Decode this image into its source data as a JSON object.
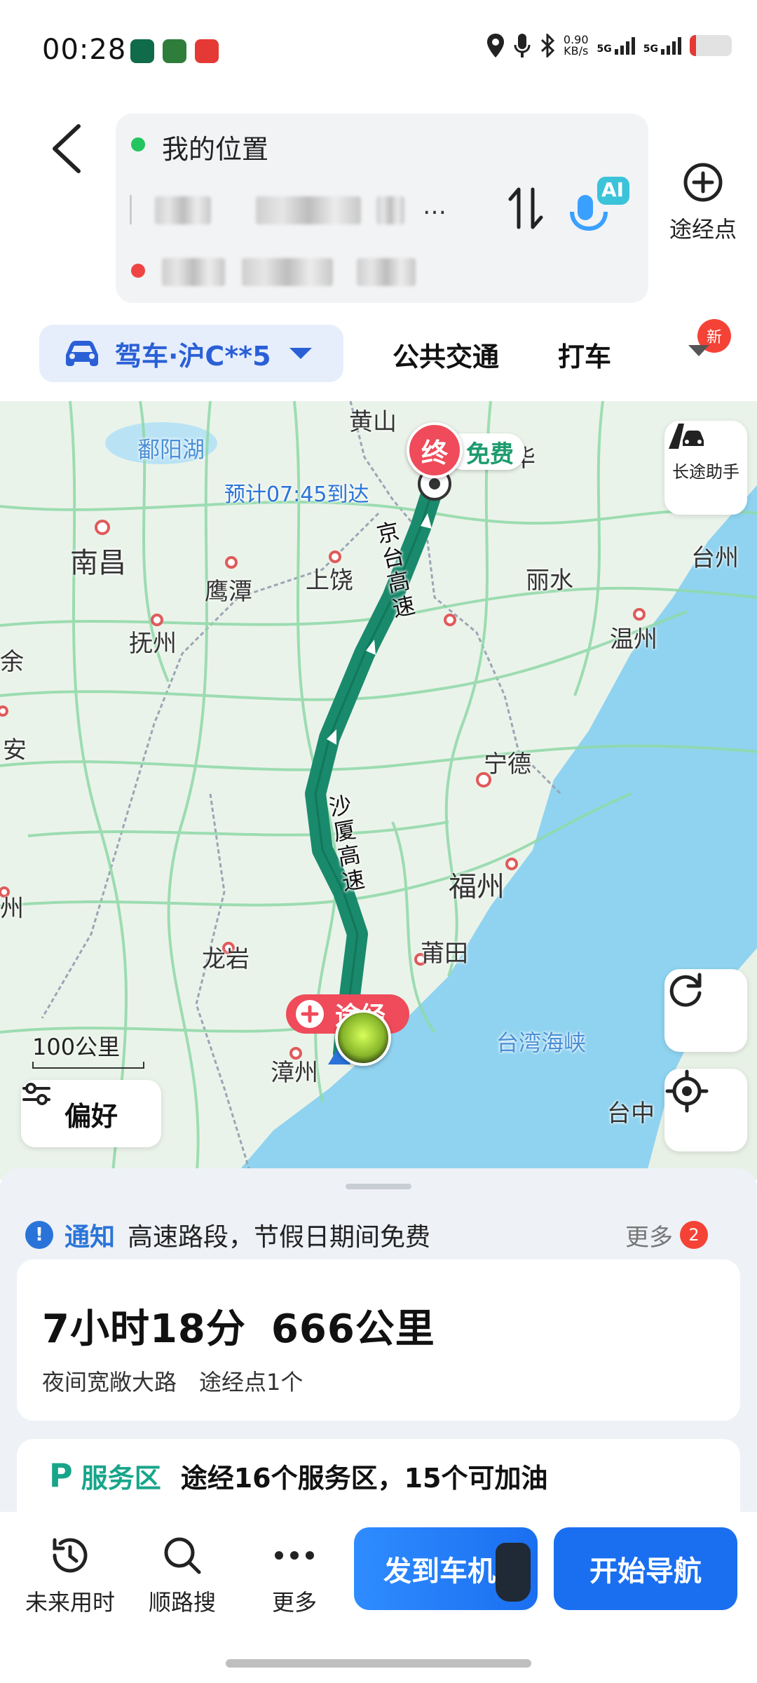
{
  "status_bar": {
    "time": "00:28",
    "net_speed_value": "0.90",
    "net_speed_unit": "KB/s",
    "signal1_label": "5G",
    "signal2_label": "5G",
    "battery_level": 0.15,
    "battery_color": "#e53935"
  },
  "search": {
    "back_icon": "chevron-left-icon",
    "origin_label": "我的位置",
    "origin_color": "#22c55e",
    "middle_obscured_suffix": "…",
    "destination_color": "#ef4444",
    "swap_icon": "swap-vertical-icon",
    "ai_label": "AI",
    "waypoint_label": "途经点"
  },
  "modes": {
    "drive_label": "驾车·沪C**5",
    "transit_label": "公共交通",
    "taxi_label": "打车",
    "new_badge": "新"
  },
  "map": {
    "cities": [
      {
        "name": "黄山"
      },
      {
        "name": "鄱阳湖"
      },
      {
        "name": "南昌"
      },
      {
        "name": "鹰潭"
      },
      {
        "name": "上饶"
      },
      {
        "name": "丽水"
      },
      {
        "name": "台州"
      },
      {
        "name": "抚州"
      },
      {
        "name": "温州"
      },
      {
        "name": "余"
      },
      {
        "name": "安"
      },
      {
        "name": "宁德"
      },
      {
        "name": "福州"
      },
      {
        "name": "州"
      },
      {
        "name": "龙岩"
      },
      {
        "name": "莆田"
      },
      {
        "name": "台湾海峡"
      },
      {
        "name": "漳州"
      },
      {
        "name": "台中"
      },
      {
        "name": "华"
      }
    ],
    "road1": "京台高速",
    "road2": "沙厦高速",
    "eta": "预计07:45到达",
    "end_label": "终",
    "free_label": "免费",
    "via_label": "途经",
    "scale_label": "100公里",
    "preference_label": "偏好",
    "long_trip_label": "长途助手",
    "refresh_icon": "refresh-icon",
    "locate_icon": "locate-icon",
    "route_color": "#1a8a6c"
  },
  "notice": {
    "title": "通知",
    "text": "高速路段，节假日期间免费",
    "more_label": "更多",
    "more_count": "2"
  },
  "route_summary": {
    "duration": "7小时18分",
    "distance": "666公里",
    "tags": "夜间宽敞大路",
    "waypoints": "途经点1个"
  },
  "service": {
    "icon_letter": "P",
    "title": "服务区",
    "text": "途经16个服务区，15个可加油"
  },
  "actions": {
    "future_time": "未来用时",
    "along_search": "顺路搜",
    "more": "更多",
    "send_to_car": "发到车机",
    "start_nav": "开始导航"
  }
}
